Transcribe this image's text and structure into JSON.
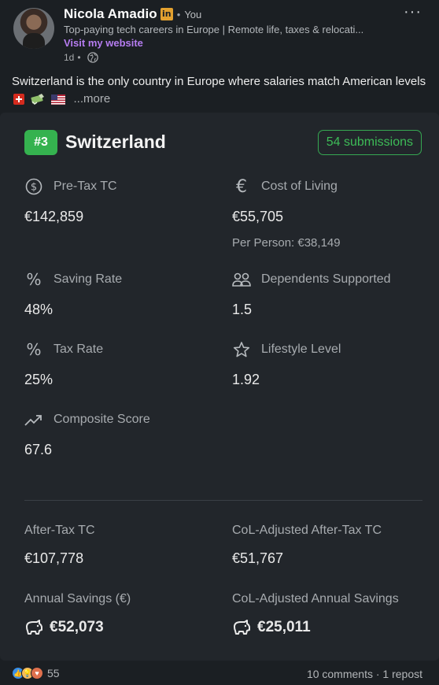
{
  "post": {
    "author_name": "Nicola Amadio",
    "author_badge": "in",
    "separator": "•",
    "connection": "You",
    "headline": "Top-paying tech careers in Europe | Remote life, taxes & relocati...",
    "website_link": "Visit my website",
    "time": "1d",
    "more_menu": "···",
    "text": "Switzerland is the only country in Europe where salaries match American levels",
    "flags": [
      "swiss-flag",
      "money-icon",
      "us-flag"
    ],
    "see_more": "...more"
  },
  "card": {
    "rank": "#3",
    "country": "Switzerland",
    "submissions": "54 submissions",
    "accent_color": "#35b24f",
    "metrics": {
      "pretax": {
        "label": "Pre-Tax TC",
        "value": "€142,859",
        "icon": "dollar-circle-icon"
      },
      "col": {
        "label": "Cost of Living",
        "value": "€55,705",
        "sub": "Per Person: €38,149",
        "icon": "euro-icon"
      },
      "saving": {
        "label": "Saving Rate",
        "value": "48%",
        "icon": "percent-icon"
      },
      "dependents": {
        "label": "Dependents Supported",
        "value": "1.5",
        "icon": "people-icon"
      },
      "tax": {
        "label": "Tax Rate",
        "value": "25%",
        "icon": "percent-icon"
      },
      "lifestyle": {
        "label": "Lifestyle Level",
        "value": "1.92",
        "icon": "star-icon"
      },
      "composite": {
        "label": "Composite Score",
        "value": "67.6",
        "icon": "trending-up-icon"
      }
    },
    "bottom": {
      "aftertax": {
        "label": "After-Tax TC",
        "value": "€107,778"
      },
      "col_aftertax": {
        "label": "CoL-Adjusted After-Tax TC",
        "value": "€51,767"
      },
      "savings": {
        "label": "Annual Savings (€)",
        "value": "€52,073",
        "icon": "piggy-bank-icon"
      },
      "col_savings": {
        "label": "CoL-Adjusted Annual Savings",
        "value": "€25,011",
        "icon": "piggy-bank-icon"
      }
    }
  },
  "footer": {
    "reaction_count": "55",
    "engagement": "10 comments · 1 repost"
  }
}
